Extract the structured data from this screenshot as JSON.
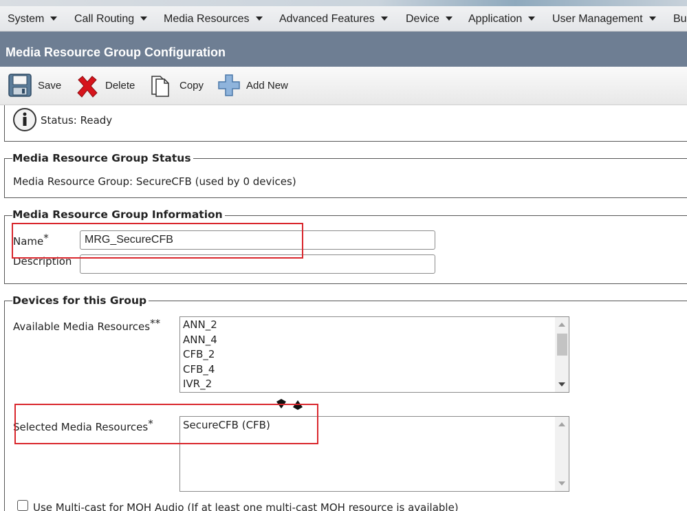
{
  "menu": {
    "items": [
      {
        "label": "System"
      },
      {
        "label": "Call Routing"
      },
      {
        "label": "Media Resources"
      },
      {
        "label": "Advanced Features"
      },
      {
        "label": "Device"
      },
      {
        "label": "Application"
      },
      {
        "label": "User Management"
      },
      {
        "label": "Bu"
      }
    ]
  },
  "page": {
    "title": "Media Resource Group Configuration"
  },
  "toolbar": {
    "save_label": "Save",
    "delete_label": "Delete",
    "copy_label": "Copy",
    "add_new_label": "Add New"
  },
  "status": {
    "text": "Status: Ready",
    "icon": "info-icon"
  },
  "group_status": {
    "title": "Media Resource Group Status",
    "text": "Media Resource Group: SecureCFB (used by 0 devices)"
  },
  "group_info": {
    "title": "Media Resource Group Information",
    "name_label": "Name",
    "name_required": "*",
    "name_value": "MRG_SecureCFB",
    "description_label": "Description",
    "description_value": ""
  },
  "devices": {
    "title": "Devices for this Group",
    "available_label": "Available Media Resources",
    "available_marker": "**",
    "available_items": [
      "ANN_2",
      "ANN_4",
      "CFB_2",
      "CFB_4",
      "IVR_2"
    ],
    "selected_label": "Selected Media Resources",
    "selected_marker": "*",
    "selected_items": [
      "SecureCFB (CFB)"
    ],
    "multicast_label": "Use Multi-cast for MOH Audio (If at least one multi-cast MOH resource is available)"
  },
  "colors": {
    "title_bar": "#6e7e93",
    "highlight_box": "#d9262c",
    "delete_icon": "#d6141c"
  }
}
